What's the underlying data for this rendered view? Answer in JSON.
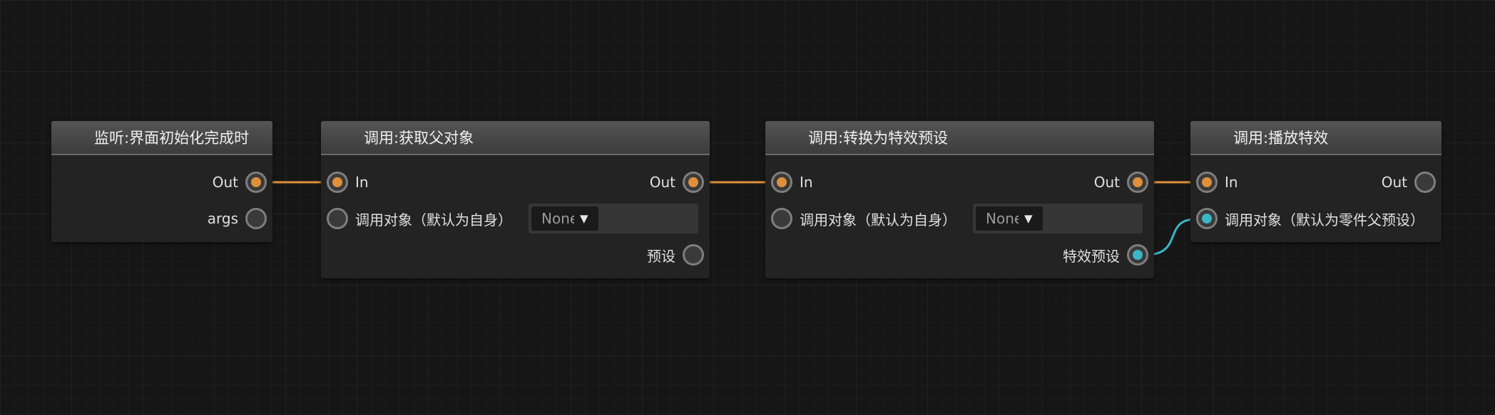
{
  "nodes": [
    {
      "title": "监听:界面初始化完成时",
      "outputs": [
        "Out",
        "args"
      ]
    },
    {
      "title": "调用:获取父对象",
      "inputs": [
        "In",
        "调用对象（默认为自身）"
      ],
      "field_value": "None",
      "outputs": [
        "Out",
        "预设"
      ]
    },
    {
      "title": "调用:转换为特效预设",
      "inputs": [
        "In",
        "调用对象（默认为自身）"
      ],
      "field_value": "None",
      "outputs": [
        "Out",
        "特效预设"
      ]
    },
    {
      "title": "调用:播放特效",
      "inputs": [
        "In",
        "调用对象（默认为零件父预设）"
      ],
      "outputs": [
        "Out"
      ]
    }
  ],
  "colors": {
    "exec_wire": "#e0903a",
    "data_wire": "#3ab6c6",
    "background": "#161616"
  }
}
